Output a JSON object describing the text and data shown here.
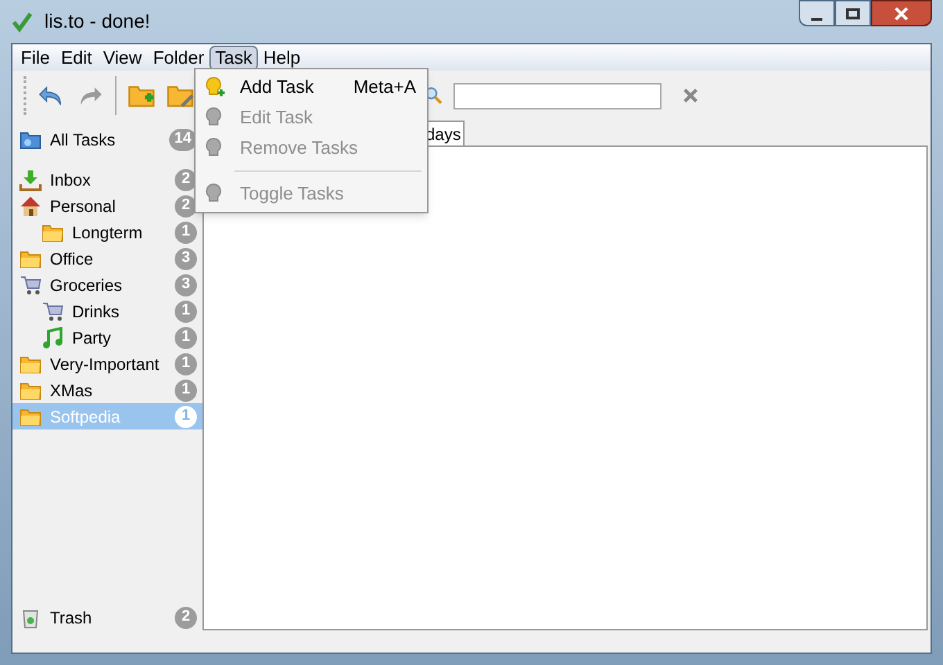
{
  "window": {
    "title": "lis.to - done!"
  },
  "menu": [
    {
      "label": "File",
      "selected": false
    },
    {
      "label": "Edit",
      "selected": false
    },
    {
      "label": "View",
      "selected": false
    },
    {
      "label": "Folder",
      "selected": false
    },
    {
      "label": "Task",
      "selected": true
    },
    {
      "label": "Help",
      "selected": false
    }
  ],
  "task_menu": [
    {
      "kind": "item",
      "label": "Add Task",
      "shortcut": "Meta+A",
      "disabled": false
    },
    {
      "kind": "item",
      "label": "Edit Task",
      "disabled": true
    },
    {
      "kind": "item",
      "label": "Remove Tasks",
      "disabled": true
    },
    {
      "kind": "separator"
    },
    {
      "kind": "item",
      "label": "Toggle Tasks",
      "disabled": true
    }
  ],
  "sidebar": {
    "top": {
      "label": "All Tasks",
      "count": "14",
      "selected": false
    },
    "items": [
      {
        "label": "Inbox",
        "count": "2",
        "selected": false
      },
      {
        "label": "Personal",
        "count": "2",
        "selected": false,
        "children": [
          {
            "label": "Longterm",
            "count": "1",
            "selected": false
          }
        ]
      },
      {
        "label": "Office",
        "count": "3",
        "selected": false
      },
      {
        "label": "Groceries",
        "count": "3",
        "selected": false,
        "children": [
          {
            "label": "Drinks",
            "count": "1",
            "selected": false
          },
          {
            "label": "Party",
            "count": "1",
            "selected": false
          }
        ]
      },
      {
        "label": "Very-Important",
        "count": "1",
        "selected": false
      },
      {
        "label": "XMas",
        "count": "1",
        "selected": false
      },
      {
        "label": "Softpedia",
        "count": "1",
        "selected": true
      }
    ],
    "trash": {
      "label": "Trash",
      "count": "2"
    }
  },
  "tabs": [
    {
      "label": "days",
      "selected": true
    }
  ]
}
